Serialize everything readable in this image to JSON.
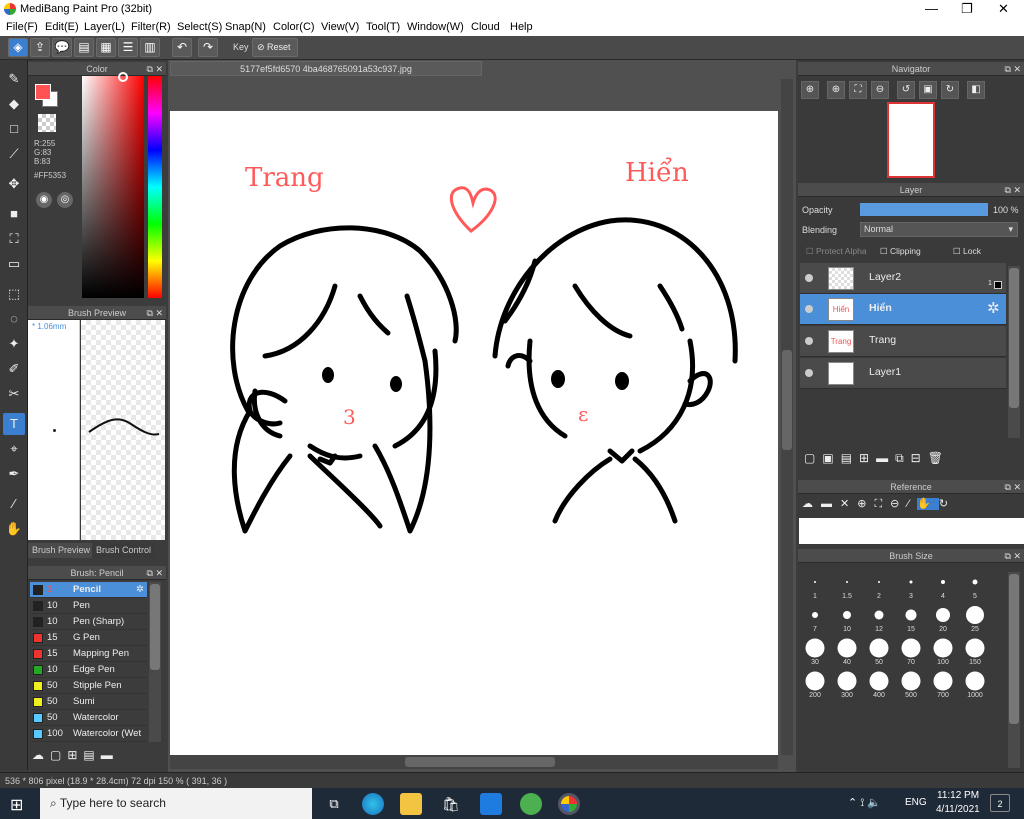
{
  "window": {
    "title": "MediBang Paint Pro (32bit)",
    "minimize": "—",
    "maximize": "❐",
    "close": "✕"
  },
  "menu": [
    "File(F)",
    "Edit(E)",
    "Layer(L)",
    "Filter(R)",
    "Select(S)",
    "Snap(N)",
    "Color(C)",
    "View(V)",
    "Tool(T)",
    "Window(W)",
    "Cloud",
    "Help"
  ],
  "toolbar": {
    "key_label": "Key",
    "reset_label": "Reset"
  },
  "color_panel": {
    "title": "Color",
    "r": "R:255",
    "g": "G:83",
    "b": "B:83",
    "hex": "#FF5353",
    "fg": "#ff5353"
  },
  "brush_preview": {
    "title": "Brush Preview",
    "size": "* 1.06mm",
    "tab1": "Brush Preview",
    "tab2": "Brush Control"
  },
  "brush_panel": {
    "title": "Brush: Pencil",
    "brushes": [
      {
        "size": "3",
        "name": "Pencil",
        "color": "#222"
      },
      {
        "size": "10",
        "name": "Pen",
        "color": "#222"
      },
      {
        "size": "10",
        "name": "Pen (Sharp)",
        "color": "#222"
      },
      {
        "size": "15",
        "name": "G Pen",
        "color": "#e33"
      },
      {
        "size": "15",
        "name": "Mapping Pen",
        "color": "#e33"
      },
      {
        "size": "10",
        "name": "Edge Pen",
        "color": "#2a2"
      },
      {
        "size": "50",
        "name": "Stipple Pen",
        "color": "#ee2"
      },
      {
        "size": "50",
        "name": "Sumi",
        "color": "#ee2"
      },
      {
        "size": "50",
        "name": "Watercolor",
        "color": "#5cf"
      },
      {
        "size": "100",
        "name": "Watercolor (Wet",
        "color": "#5cf"
      }
    ]
  },
  "document": {
    "tab": "5177ef5fd6570 4ba468765091a53c937.jpg",
    "text_trang": "Trang",
    "text_hien": "Hiển"
  },
  "navigator": {
    "title": "Navigator"
  },
  "layer_panel": {
    "title": "Layer",
    "opacity_label": "Opacity",
    "opacity_value": "100 %",
    "opacity": 1.0,
    "blending_label": "Blending",
    "blending_value": "Normal",
    "protect_alpha": "Protect Alpha",
    "clipping": "Clipping",
    "lock": "Lock",
    "layers": [
      {
        "name": "Layer2",
        "thumb": ""
      },
      {
        "name": "Hiển",
        "thumb": "Hiển"
      },
      {
        "name": "Trang",
        "thumb": "Trang"
      },
      {
        "name": "Layer1",
        "thumb": ""
      }
    ],
    "badge": "1"
  },
  "reference": {
    "title": "Reference"
  },
  "brush_size": {
    "title": "Brush Size",
    "sizes": [
      "1",
      "1.5",
      "2",
      "3",
      "4",
      "5",
      "7",
      "10",
      "12",
      "15",
      "20",
      "25",
      "30",
      "40",
      "50",
      "70",
      "100",
      "150",
      "200",
      "300",
      "400",
      "500",
      "700",
      "1000"
    ]
  },
  "status": {
    "text": "536 * 806 pixel   (18.9 * 28.4cm)   72 dpi   150 %   ( 391, 36 )"
  },
  "taskbar": {
    "search_placeholder": "Type here to search",
    "time": "11:12 PM",
    "date": "4/11/2021",
    "lang": "ENG",
    "notif": "2"
  }
}
